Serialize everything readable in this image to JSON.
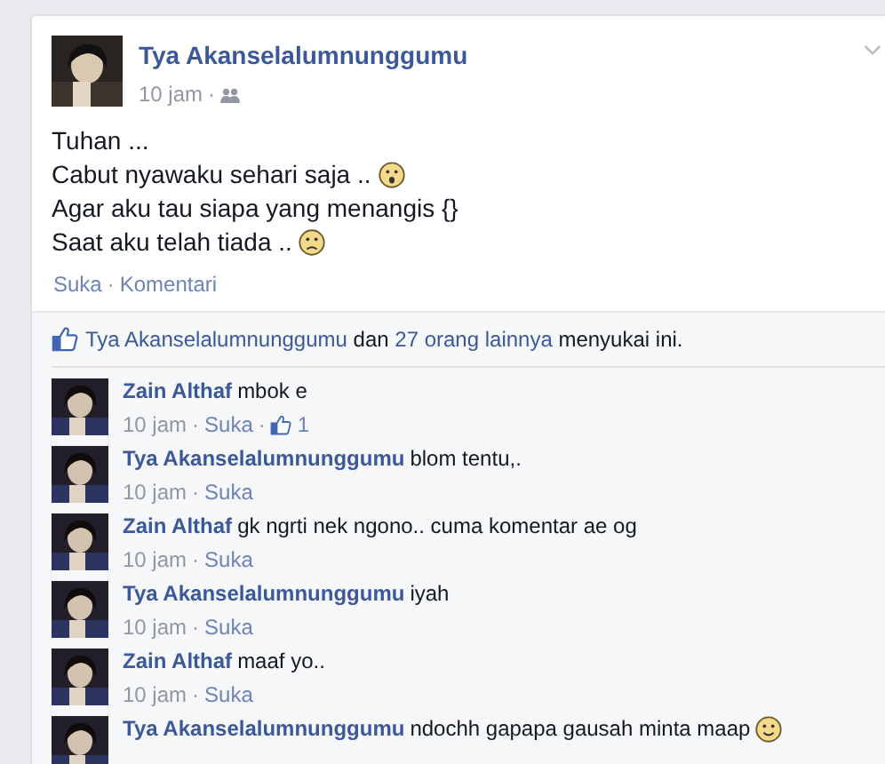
{
  "post": {
    "author": "Tya Akanselalumnunggumu",
    "time": "10 jam",
    "separator": "·",
    "lines": [
      {
        "text": "Tuhan ...",
        "kind": "plain"
      },
      {
        "text": "Cabut nyawaku sehari saja ..",
        "kind": "surprised"
      },
      {
        "text": "Agar aku tau siapa yang menangis {}",
        "kind": "plain"
      },
      {
        "text": "Saat aku telah tiada ..",
        "kind": "sad"
      }
    ],
    "actions": [
      "Suka",
      "Komentari"
    ]
  },
  "likes": {
    "first": "Tya Akanselalumnunggumu",
    "and": "dan",
    "others": "27 orang lainnya",
    "rest": "menyukai ini."
  },
  "comments": [
    {
      "kind": "plain",
      "author": "Zain Althaf",
      "text": "mbok e",
      "time": "10 jam",
      "like": "Suka",
      "likes": "1"
    },
    {
      "kind": "plain",
      "author": "Tya Akanselalumnunggumu",
      "text": "blom tentu,.",
      "time": "10 jam",
      "like": "Suka"
    },
    {
      "kind": "plain",
      "author": "Zain Althaf",
      "text": "gk ngrti nek ngono.. cuma komentar ae og",
      "time": "10 jam",
      "like": "Suka"
    },
    {
      "kind": "plain",
      "author": "Tya Akanselalumnunggumu",
      "text": "iyah",
      "time": "10 jam",
      "like": "Suka"
    },
    {
      "kind": "plain",
      "author": "Zain Althaf",
      "text": "maaf yo..",
      "time": "10 jam",
      "like": "Suka"
    },
    {
      "kind": "smile",
      "author": "Tya Akanselalumnunggumu",
      "text": "ndochh gapapa gausah minta maap"
    }
  ]
}
